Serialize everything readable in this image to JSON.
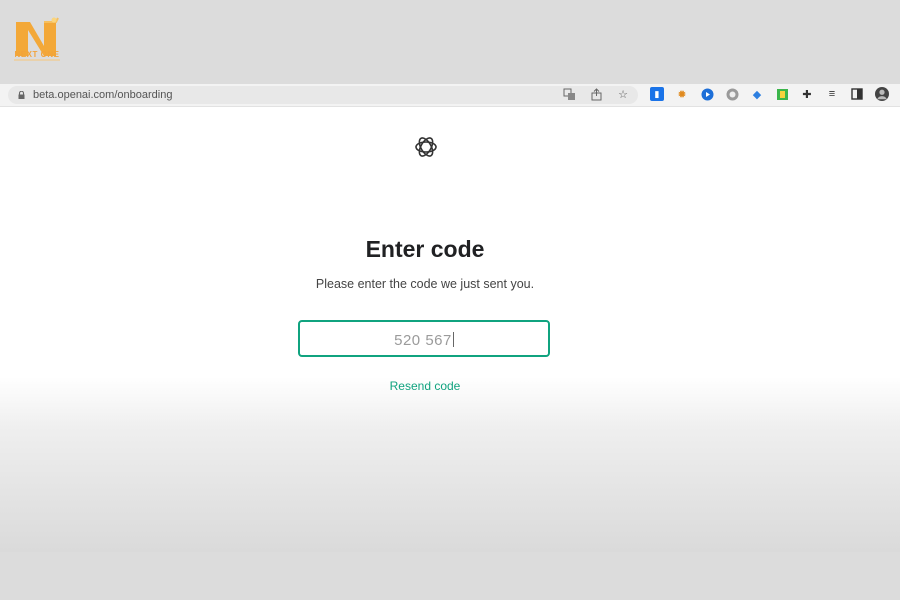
{
  "watermark": {
    "brand_name": "NEXT ONE"
  },
  "browser": {
    "url": "beta.openai.com/onboarding",
    "omnibox_icons": [
      "translate-icon",
      "share-icon",
      "bookmark-star-icon"
    ],
    "extension_icons": [
      "extension-blue-icon",
      "extension-orange-icon",
      "extension-play-icon",
      "extension-grey-icon",
      "extension-tag-icon",
      "extension-green-icon",
      "extensions-puzzle-icon",
      "reading-list-icon",
      "side-panel-icon",
      "profile-avatar-icon"
    ]
  },
  "page": {
    "title": "Enter code",
    "subtitle": "Please enter the code we just sent you.",
    "code_value": "520 567",
    "resend_label": "Resend code"
  },
  "colors": {
    "accent": "#10a37f",
    "title": "#202123",
    "brand": "#f2a33a"
  }
}
